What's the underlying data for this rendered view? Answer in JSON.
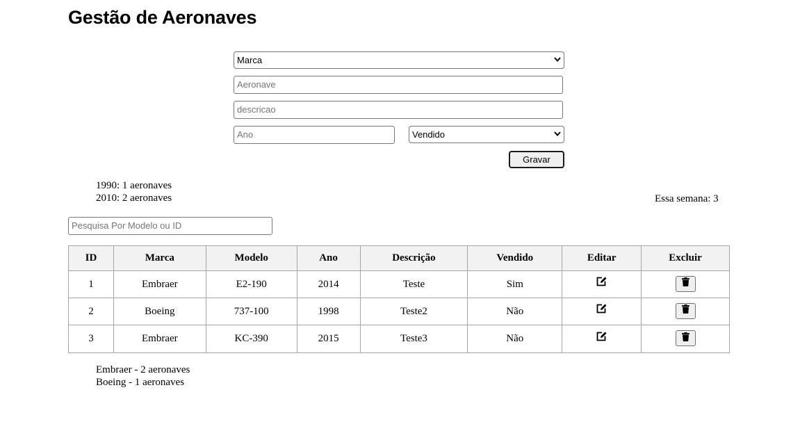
{
  "page": {
    "title": "Gestão de Aeronaves"
  },
  "form": {
    "marca_select": {
      "selected": "Marca"
    },
    "aeronave_input": {
      "value": "",
      "placeholder": "Aeronave"
    },
    "descricao_input": {
      "value": "",
      "placeholder": "descricao"
    },
    "ano_input": {
      "value": "",
      "placeholder": "Ano"
    },
    "vendido_select": {
      "selected": "Vendido"
    },
    "gravar_label": "Gravar"
  },
  "stats": {
    "by_year": [
      "1990: 1 aeronaves",
      "2010: 2 aeronaves"
    ],
    "week": "Essa semana: 3",
    "by_brand": [
      "Embraer - 2 aeronaves",
      "Boeing - 1 aeronaves"
    ]
  },
  "search": {
    "value": "",
    "placeholder": "Pesquisa Por Modelo ou ID"
  },
  "table": {
    "headers": [
      "ID",
      "Marca",
      "Modelo",
      "Ano",
      "Descrição",
      "Vendido",
      "Editar",
      "Excluir"
    ],
    "rows": [
      {
        "id": "1",
        "marca": "Embraer",
        "modelo": "E2-190",
        "ano": "2014",
        "descricao": "Teste",
        "vendido": "Sim"
      },
      {
        "id": "2",
        "marca": "Boeing",
        "modelo": "737-100",
        "ano": "1998",
        "descricao": "Teste2",
        "vendido": "Não"
      },
      {
        "id": "3",
        "marca": "Embraer",
        "modelo": "KC-390",
        "ano": "2015",
        "descricao": "Teste3",
        "vendido": "Não"
      }
    ],
    "edit_icon": "edit-icon",
    "delete_icon": "trash-icon"
  }
}
